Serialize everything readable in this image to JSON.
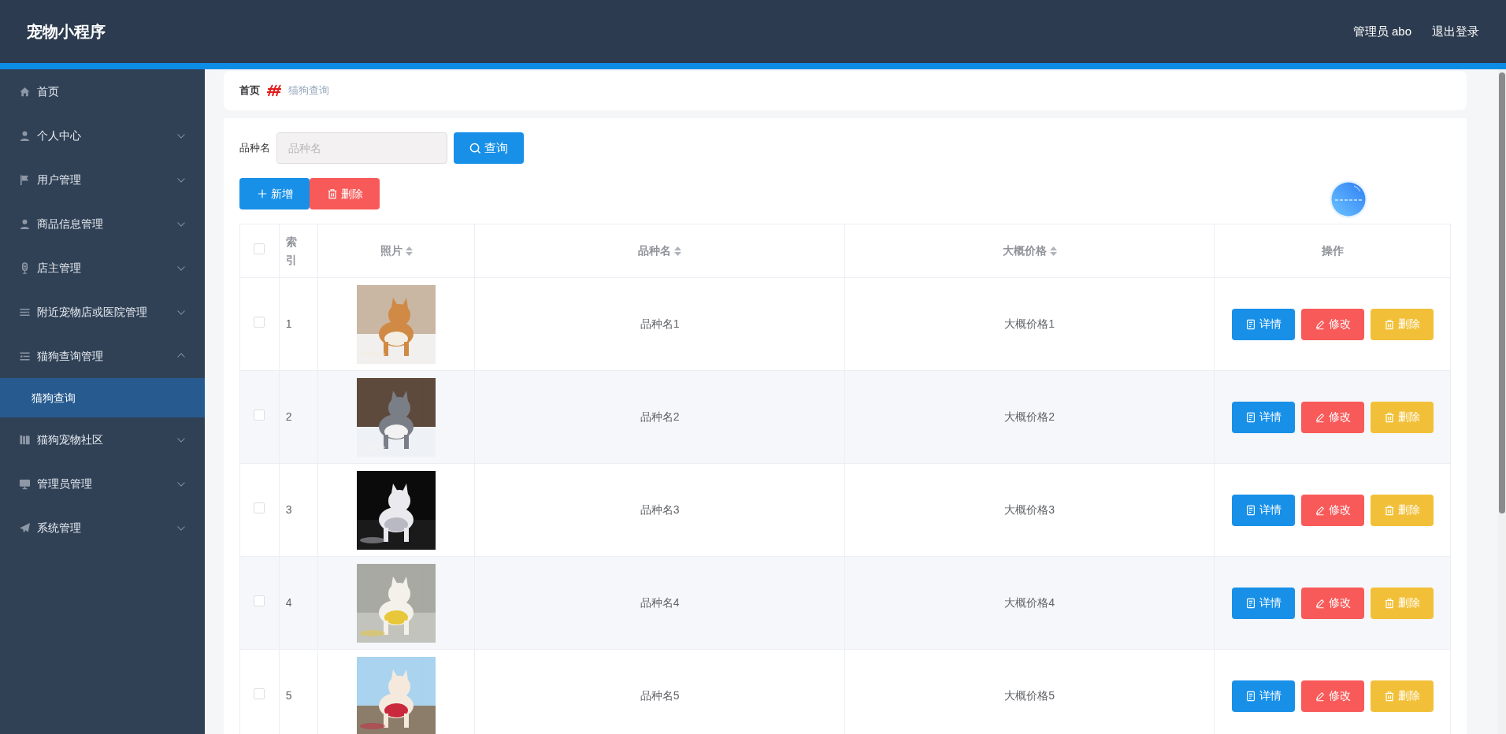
{
  "header": {
    "title": "宠物小程序",
    "user": "管理员 abo",
    "logout": "退出登录"
  },
  "sidebar": {
    "items": [
      {
        "label": "首页",
        "kind": "link"
      },
      {
        "label": "个人中心",
        "kind": "menu",
        "expanded": false
      },
      {
        "label": "用户管理",
        "kind": "menu",
        "expanded": false
      },
      {
        "label": "商品信息管理",
        "kind": "menu",
        "expanded": false
      },
      {
        "label": "店主管理",
        "kind": "menu",
        "expanded": false
      },
      {
        "label": "附近宠物店或医院管理",
        "kind": "menu",
        "expanded": false
      },
      {
        "label": "猫狗查询管理",
        "kind": "menu",
        "expanded": true,
        "children": [
          {
            "label": "猫狗查询",
            "selected": true
          }
        ]
      },
      {
        "label": "猫狗宠物社区",
        "kind": "menu",
        "expanded": false
      },
      {
        "label": "管理员管理",
        "kind": "menu",
        "expanded": false
      },
      {
        "label": "系统管理",
        "kind": "menu",
        "expanded": false
      }
    ]
  },
  "breadcrumb": [
    {
      "label": "首页",
      "current": false
    },
    {
      "label": "猫狗查询",
      "current": true
    }
  ],
  "search": {
    "label": "品种名",
    "placeholder": "品种名",
    "button": "查询"
  },
  "toolbar": [
    {
      "label": "新增",
      "kind": "add"
    },
    {
      "label": "删除",
      "kind": "delete"
    }
  ],
  "table": {
    "select_all_checked": false,
    "columns": [
      {
        "label": "索引",
        "sortable": false
      },
      {
        "label": "照片",
        "sortable": true
      },
      {
        "label": "品种名",
        "sortable": true
      },
      {
        "label": "大概价格",
        "sortable": true
      },
      {
        "label": "操作",
        "sortable": false
      }
    ],
    "rows": [
      {
        "checked": false,
        "index": "1",
        "name": "品种名1",
        "price": "大概价格1",
        "actions": [
          {
            "label": "详情",
            "kind": "detail"
          },
          {
            "label": "修改",
            "kind": "edit"
          },
          {
            "label": "删除",
            "kind": "delete"
          }
        ]
      },
      {
        "checked": false,
        "index": "2",
        "name": "品种名2",
        "price": "大概价格2",
        "actions": [
          {
            "label": "详情",
            "kind": "detail"
          },
          {
            "label": "修改",
            "kind": "edit"
          },
          {
            "label": "删除",
            "kind": "delete"
          }
        ]
      },
      {
        "checked": false,
        "index": "3",
        "name": "品种名3",
        "price": "大概价格3",
        "actions": [
          {
            "label": "详情",
            "kind": "detail"
          },
          {
            "label": "修改",
            "kind": "edit"
          },
          {
            "label": "删除",
            "kind": "delete"
          }
        ]
      },
      {
        "checked": false,
        "index": "4",
        "name": "品种名4",
        "price": "大概价格4",
        "actions": [
          {
            "label": "详情",
            "kind": "detail"
          },
          {
            "label": "修改",
            "kind": "edit"
          },
          {
            "label": "删除",
            "kind": "delete"
          }
        ]
      },
      {
        "checked": false,
        "index": "5",
        "name": "品种名5",
        "price": "大概价格5",
        "actions": [
          {
            "label": "详情",
            "kind": "detail"
          },
          {
            "label": "修改",
            "kind": "edit"
          },
          {
            "label": "删除",
            "kind": "delete"
          }
        ]
      }
    ]
  }
}
